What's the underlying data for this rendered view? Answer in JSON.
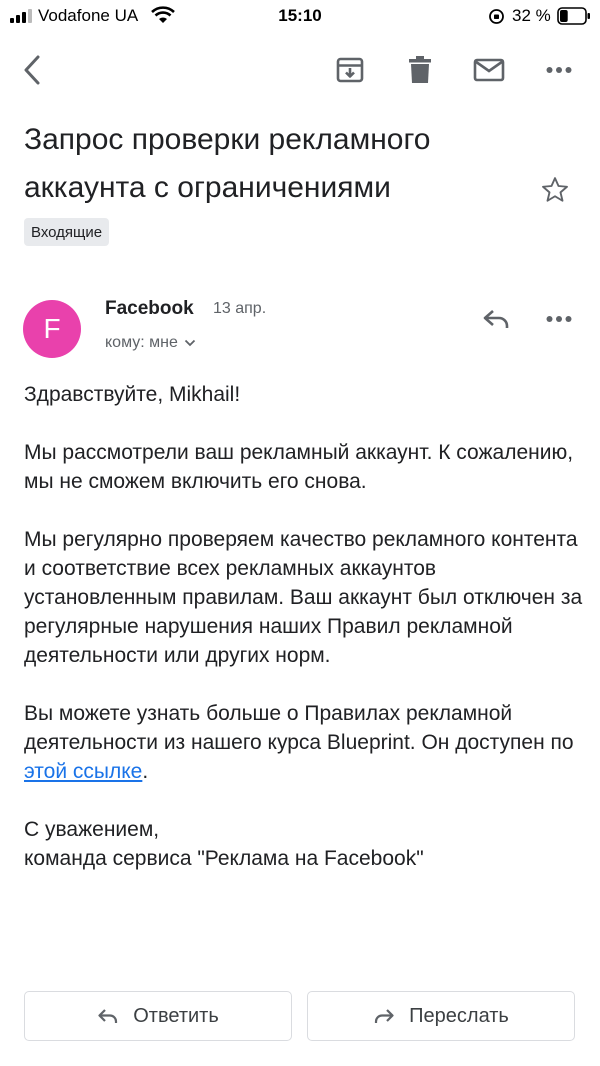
{
  "status_bar": {
    "carrier": "Vodafone UA",
    "time": "15:10",
    "battery_percent": "32 %",
    "battery_level": 0.32
  },
  "toolbar": {
    "back_icon": "chevron-left-icon",
    "archive_icon": "archive-icon",
    "delete_icon": "trash-icon",
    "mark_unread_icon": "mail-icon",
    "more_icon": "more-horizontal-icon"
  },
  "email": {
    "subject": "Запрос проверки рекламного аккаунта с ограничениями",
    "label": "Входящие",
    "starred": false,
    "sender": {
      "initial": "F",
      "name": "Facebook",
      "avatar_color": "#e941ac"
    },
    "date": "13 апр.",
    "recipient": "кому: мне",
    "greeting": "Здравствуйте, Mikhail!",
    "paragraph1": "Мы рассмотрели ваш рекламный аккаунт. К сожалению, мы не сможем включить его снова.",
    "paragraph2": "Мы регулярно проверяем качество рекламного контента и соответствие всех рекламных аккаунтов установленным правилам. Ваш аккаунт был отключен за регулярные нарушения наших Правил рекламной деятельности или других норм.",
    "paragraph3_before_link": "Вы можете узнать больше о Правилах рекламной деятельности из нашего курса Blueprint. Он доступен по ",
    "paragraph3_link": "этой ссылке",
    "paragraph3_after_link": ".",
    "signoff_line1": "С уважением,",
    "signoff_line2": "команда сервиса \"Реклама на Facebook\""
  },
  "actions": {
    "reply_label": "Ответить",
    "forward_label": "Переслать"
  },
  "colors": {
    "link": "#1a73e8",
    "icon": "#5f6368",
    "chip_bg": "#e8eaed"
  }
}
